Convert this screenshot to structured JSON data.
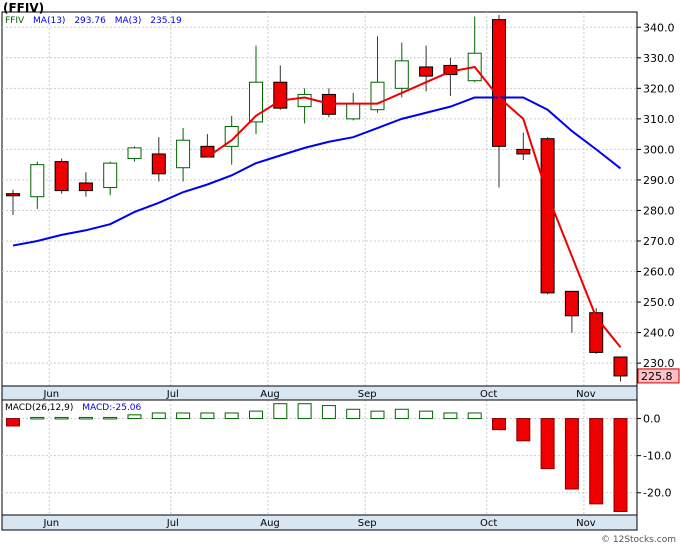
{
  "ticker": "(FFIV)",
  "legend": {
    "symbol": "FFIV",
    "ma13_label": "MA(13)",
    "ma13_value": "293.76",
    "ma3_label": "MA(3)",
    "ma3_value": "235.19",
    "ma13_color": "#0000ee",
    "ma3_color": "#ee0000"
  },
  "macd_legend": {
    "params_label": "MACD(26,12,9)",
    "value_label": "MACD:-25.06"
  },
  "last_price_label": "225.8",
  "watermark": "© 12Stocks.com",
  "colors": {
    "up_fill": "#ffffff",
    "down_fill": "#ee0000",
    "up_border": "#006400",
    "macd_pos_border": "#006400",
    "macd_neg_fill": "#ee0000",
    "grid": "#cccccc",
    "axis_bg": "#d8e6f2"
  },
  "chart_data": {
    "type": "candlestick",
    "months": [
      {
        "label": "Jun",
        "index": 1
      },
      {
        "label": "Jul",
        "index": 6
      },
      {
        "label": "Aug",
        "index": 10
      },
      {
        "label": "Sep",
        "index": 14
      },
      {
        "label": "Oct",
        "index": 19
      },
      {
        "label": "Nov",
        "index": 23
      }
    ],
    "price_ylim": [
      222.5,
      345
    ],
    "price_ticks": [
      230,
      240,
      250,
      260,
      270,
      280,
      290,
      300,
      310,
      320,
      330,
      340
    ],
    "candles": [
      {
        "o": 285.5,
        "h": 286.8,
        "l": 278.5,
        "c": 284.8
      },
      {
        "o": 284.5,
        "h": 296,
        "l": 280.5,
        "c": 295
      },
      {
        "o": 296,
        "h": 297,
        "l": 285.5,
        "c": 286.5
      },
      {
        "o": 289,
        "h": 292.5,
        "l": 284.5,
        "c": 286.5
      },
      {
        "o": 287.5,
        "h": 296,
        "l": 285,
        "c": 295.5
      },
      {
        "o": 297,
        "h": 301,
        "l": 296,
        "c": 300.5
      },
      {
        "o": 298.5,
        "h": 304,
        "l": 289.5,
        "c": 292
      },
      {
        "o": 294,
        "h": 307,
        "l": 289.5,
        "c": 303
      },
      {
        "o": 301,
        "h": 305,
        "l": 297.5,
        "c": 297.5
      },
      {
        "o": 301,
        "h": 311,
        "l": 295,
        "c": 307.5
      },
      {
        "o": 309,
        "h": 334,
        "l": 305,
        "c": 322
      },
      {
        "o": 322,
        "h": 327.5,
        "l": 313,
        "c": 313.5
      },
      {
        "o": 314,
        "h": 320,
        "l": 308.5,
        "c": 318
      },
      {
        "o": 318,
        "h": 320,
        "l": 310.5,
        "c": 311.5
      },
      {
        "o": 310,
        "h": 318.5,
        "l": 309.5,
        "c": 315
      },
      {
        "o": 313,
        "h": 337,
        "l": 312,
        "c": 322
      },
      {
        "o": 320,
        "h": 335,
        "l": 317,
        "c": 329
      },
      {
        "o": 327,
        "h": 334,
        "l": 319,
        "c": 324
      },
      {
        "o": 327.5,
        "h": 330,
        "l": 317.5,
        "c": 324.5
      },
      {
        "o": 322.5,
        "h": 343.5,
        "l": 322,
        "c": 331.5
      },
      {
        "o": 342.5,
        "h": 344,
        "l": 287.5,
        "c": 301
      },
      {
        "o": 300,
        "h": 305.5,
        "l": 296.5,
        "c": 298.5
      },
      {
        "o": 303.5,
        "h": 304,
        "l": 252.5,
        "c": 253
      },
      {
        "o": 253.5,
        "h": 253.5,
        "l": 240,
        "c": 245.5
      },
      {
        "o": 246.5,
        "h": 248,
        "l": 233,
        "c": 233.5
      },
      {
        "o": 232,
        "h": 232,
        "l": 224,
        "c": 225.8
      }
    ],
    "ma13": [
      268.5,
      270,
      272,
      273.5,
      275.5,
      279.5,
      282.5,
      286,
      288.5,
      291.5,
      295.5,
      298,
      300.5,
      302.5,
      304,
      307,
      310,
      312,
      314,
      317,
      317,
      317,
      313,
      306,
      300,
      293.76
    ],
    "ma3": [
      null,
      null,
      null,
      null,
      null,
      null,
      null,
      null,
      297.5,
      303,
      311,
      316,
      317,
      315,
      315,
      315,
      318.5,
      322,
      325.5,
      327,
      317,
      310,
      285,
      265,
      245,
      235.19
    ],
    "macd_ylim": [
      -26,
      5
    ],
    "macd_ticks": [
      0,
      -10,
      -20
    ],
    "macd": [
      -2,
      0.3,
      0.3,
      0.3,
      0.3,
      1,
      1.5,
      1.5,
      1.5,
      1.5,
      2,
      4,
      4,
      3.5,
      2.5,
      2,
      2.5,
      2,
      1.5,
      1.5,
      -3,
      -6,
      -13.5,
      -19,
      -23,
      -25.06
    ]
  }
}
